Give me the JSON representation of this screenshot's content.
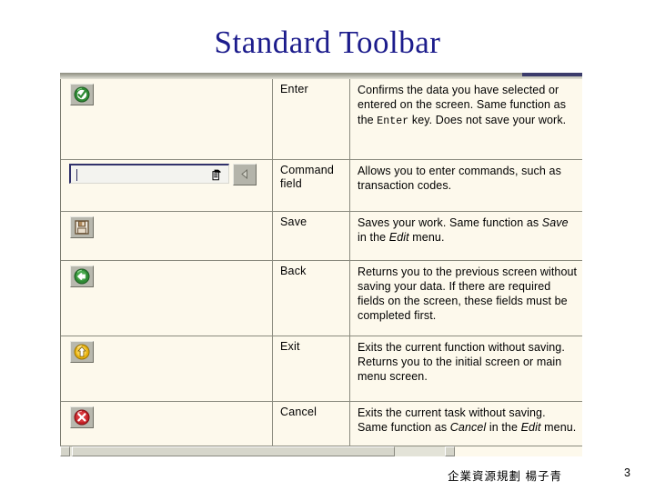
{
  "slide": {
    "title": "Standard Toolbar",
    "title_color": "#1c1c8c",
    "background_color": "#ffffff"
  },
  "screenshot": {
    "background_color": "#fdf9ec",
    "border_color": "#8a8a7e",
    "scrollbar": {
      "left_arrow": "◄",
      "right_arrow": "►",
      "thumb_position": "left"
    }
  },
  "table": {
    "rows": [
      {
        "icon_name": "enter-check-icon",
        "icon_kind": "button",
        "icon_color": "#2f8a34",
        "name": "Enter",
        "description_html": "Confirms the data you have selected or entered on the screen. Same function as the <span class=\"mono\">Enter</span> key. Does not save your work.",
        "description_text": "Confirms the data you have selected or entered on the screen. Same function as the Enter key. Does not save your work."
      },
      {
        "icon_name": "command-field",
        "icon_kind": "command-field",
        "field_value": "",
        "field_placeholder": "",
        "name": "Command field",
        "description_html": "Allows you to enter commands, such as transaction codes.",
        "description_text": "Allows you to enter commands, such as transaction codes."
      },
      {
        "icon_name": "save-floppy-icon",
        "icon_kind": "button",
        "icon_color": "#9b7b52",
        "name": "Save",
        "description_html": "Saves your work. Same function as <i>Save</i> in the <i>Edit</i> menu.",
        "description_text": "Saves your work. Same function as Save in the Edit menu."
      },
      {
        "icon_name": "back-arrow-icon",
        "icon_kind": "button",
        "icon_color": "#2f8a34",
        "name": "Back",
        "description_html": "Returns you to the previous screen without saving your data. If there are required fields on the screen, these fields must be completed first.",
        "description_text": "Returns you to the previous screen without saving your data. If there are required fields on the screen, these fields must be completed first."
      },
      {
        "icon_name": "exit-up-arrow-icon",
        "icon_kind": "button",
        "icon_color": "#e8b10c",
        "name": "Exit",
        "description_html": "Exits the current function without saving. Returns you to the initial screen or main menu screen.",
        "description_text": "Exits the current function without saving. Returns you to the initial screen or main menu screen."
      },
      {
        "icon_name": "cancel-x-icon",
        "icon_kind": "button",
        "icon_color": "#c32126",
        "name": "Cancel",
        "description_html": "Exits the current task without saving. Same function as <i>Cancel</i> in the <i>Edit</i> menu.",
        "description_text": "Exits the current task without saving. Same function as Cancel in the Edit menu."
      }
    ]
  },
  "footer": {
    "note": "企業資源規劃 楊子青",
    "page_number": "3"
  }
}
